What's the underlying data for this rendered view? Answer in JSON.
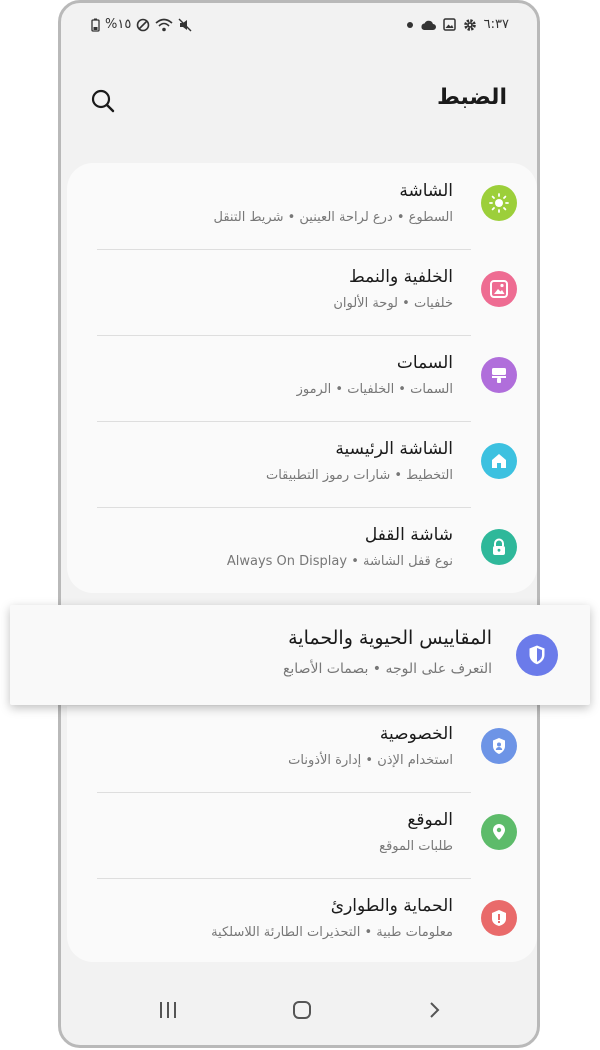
{
  "status": {
    "battery": "%١٥",
    "time": "٦:٣٧"
  },
  "header": {
    "title": "الضبط"
  },
  "items_top": [
    {
      "title": "الشاشة",
      "subtitle": "السطوع  •  درع لراحة العينين  •  شريط التنقل",
      "icon": "brightness-icon",
      "color": "#9ccf3a"
    },
    {
      "title": "الخلفية والنمط",
      "subtitle": "خلفيات  •  لوحة الألوان",
      "icon": "wallpaper-icon",
      "color": "#ee6c92"
    },
    {
      "title": "السمات",
      "subtitle": "السمات  •  الخلفيات  •  الرموز",
      "icon": "themes-icon",
      "color": "#b06edb"
    },
    {
      "title": "الشاشة الرئيسية",
      "subtitle": "التخطيط  •  شارات رموز التطبيقات",
      "icon": "home-icon",
      "color": "#3cc1e0"
    },
    {
      "title": "شاشة القفل",
      "subtitle": "نوع قفل الشاشة  •  Always On Display",
      "icon": "lock-icon",
      "color": "#2fb89a"
    }
  ],
  "highlight": {
    "title": "المقاييس الحيوية والحماية",
    "subtitle": "التعرف على الوجه  •  بصمات الأصابع",
    "icon": "shield-icon",
    "color": "#6b7bea"
  },
  "items_bottom": [
    {
      "title": "الخصوصية",
      "subtitle": "استخدام الإذن  •  إدارة الأذونات",
      "icon": "privacy-icon",
      "color": "#6d94e6"
    },
    {
      "title": "الموقع",
      "subtitle": "طلبات الموقع",
      "icon": "location-icon",
      "color": "#5dbb6a"
    },
    {
      "title": "الحماية والطوارئ",
      "subtitle": "معلومات طبية  •  التحذيرات الطارئة اللاسلكية",
      "icon": "emergency-icon",
      "color": "#e96a6a"
    }
  ]
}
